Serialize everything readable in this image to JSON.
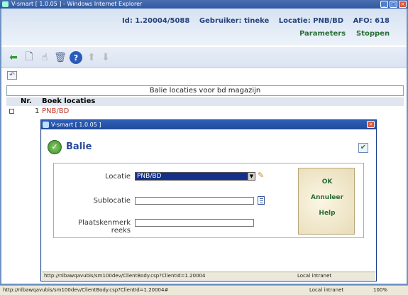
{
  "window": {
    "title": "V-smart [ 1.0.05 ] - Windows Internet Explorer"
  },
  "header": {
    "id": "Id: 1.20004/5088",
    "user": "Gebruiker: tineke",
    "location": "Locatie: PNB/BD",
    "afo": "AFO: 618",
    "parameters": "Parameters",
    "stop": "Stoppen"
  },
  "toolbar": {
    "icons": [
      "back-arrow-icon",
      "new-document-icon",
      "hand-icon",
      "delete-icon",
      "help-icon",
      "up-icon",
      "down-icon"
    ]
  },
  "banner": "Balie locaties voor bd magazijn",
  "grid": {
    "col_nr": "Nr.",
    "col_locaties": "Boek locaties",
    "rows": [
      {
        "nr": "1",
        "locatie": "PNB/BD"
      }
    ]
  },
  "dialog": {
    "title": "V-smart [ 1.0.05 ]",
    "heading": "Balie",
    "fields": {
      "locatie_label": "Locatie",
      "locatie_value": "PNB/BD",
      "sublocatie_label": "Sublocatie",
      "sublocatie_value": "",
      "plaats_label": "Plaatskenmerk reeks",
      "plaats_value": ""
    },
    "buttons": {
      "ok": "OK",
      "annuleer": "Annuleer",
      "help": "Help"
    },
    "status_url": "http://nlbawqavubis/sm100dev/ClientBody.csp?ClientId=1.20004",
    "status_zone": "Local intranet"
  },
  "statusbar": {
    "url": "http://nlbawqavubis/sm100dev/ClientBody.csp?ClientId=1.20004#",
    "zone": "Local intranet",
    "zoom": "100%"
  }
}
